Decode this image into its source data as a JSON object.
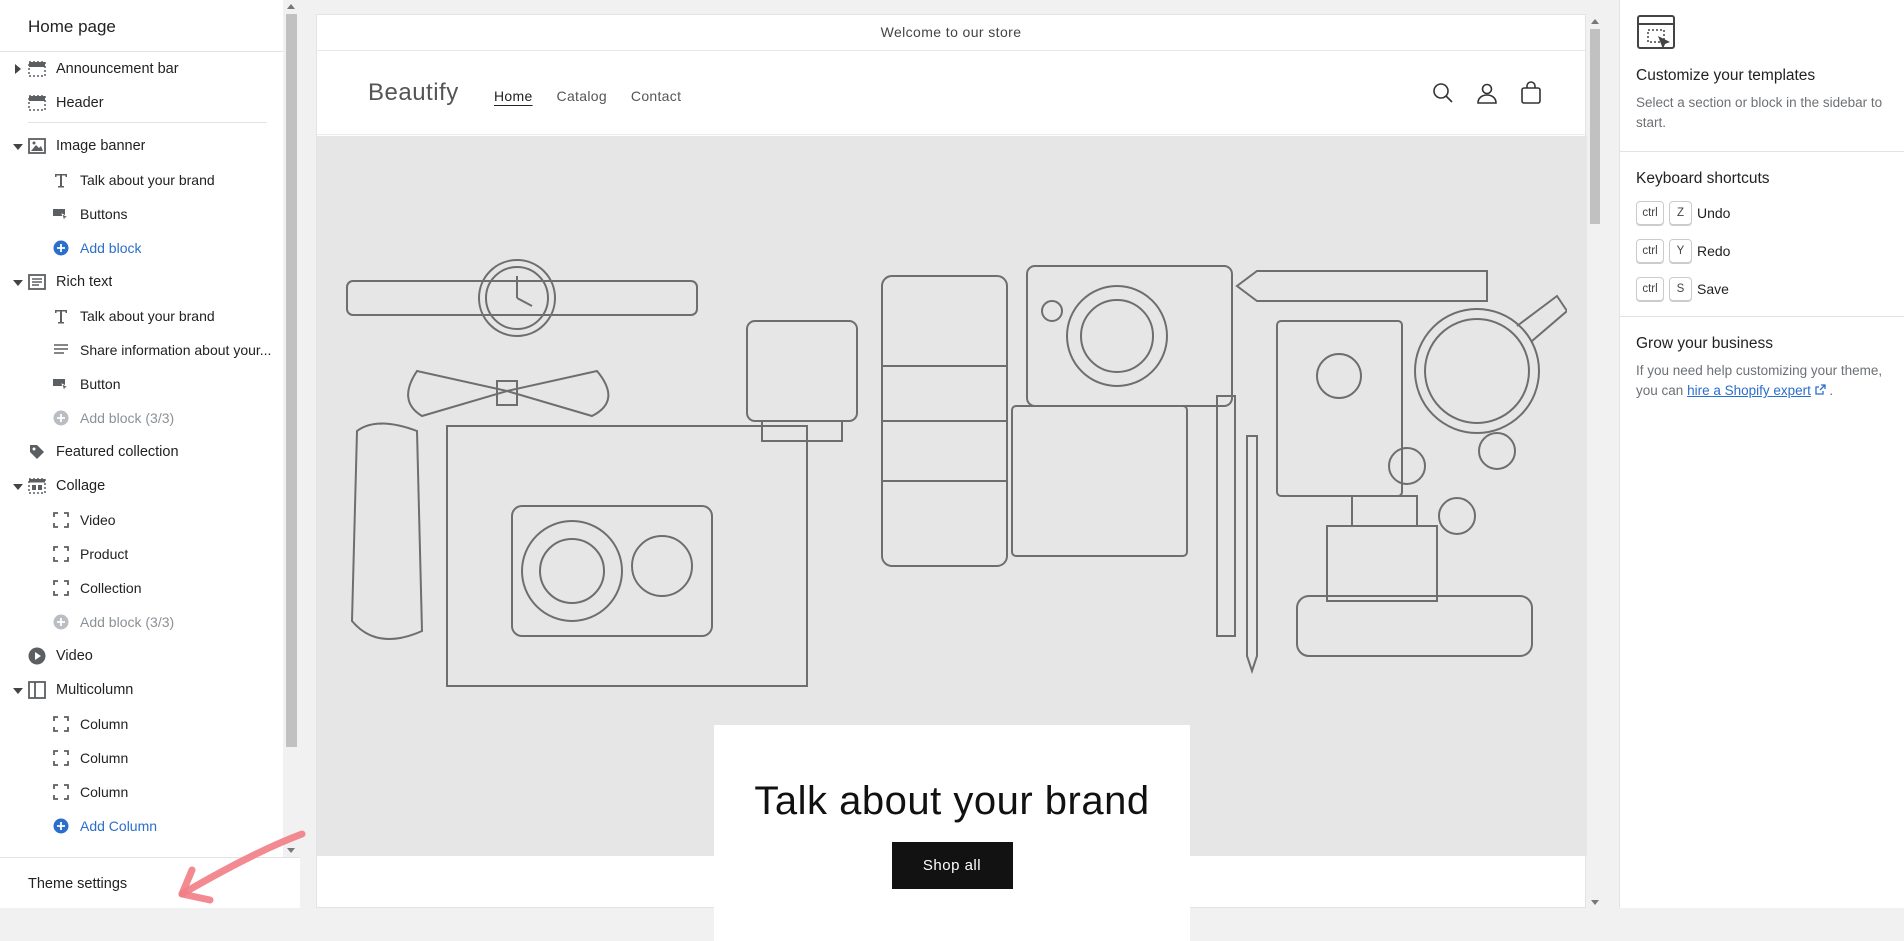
{
  "sidebar": {
    "title": "Home page",
    "items": [
      {
        "label": "Announcement bar"
      },
      {
        "label": "Header"
      },
      {
        "label": "Image banner"
      },
      {
        "label": "Talk about your brand"
      },
      {
        "label": "Buttons"
      },
      {
        "label": "Add block"
      },
      {
        "label": "Rich text"
      },
      {
        "label": "Talk about your brand"
      },
      {
        "label": "Share information about your..."
      },
      {
        "label": "Button"
      },
      {
        "label": "Add block (3/3)"
      },
      {
        "label": "Featured collection"
      },
      {
        "label": "Collage"
      },
      {
        "label": "Video"
      },
      {
        "label": "Product"
      },
      {
        "label": "Collection"
      },
      {
        "label": "Add block (3/3)"
      },
      {
        "label": "Video"
      },
      {
        "label": "Multicolumn"
      },
      {
        "label": "Column"
      },
      {
        "label": "Column"
      },
      {
        "label": "Column"
      },
      {
        "label": "Add Column"
      }
    ],
    "footer_label": "Theme settings"
  },
  "preview": {
    "announcement": "Welcome to our store",
    "logo": "Beautify",
    "nav": [
      "Home",
      "Catalog",
      "Contact"
    ],
    "banner_heading": "Talk about your brand",
    "banner_button": "Shop all"
  },
  "right_panel": {
    "customize_title": "Customize your templates",
    "customize_text": "Select a section or block in the sidebar to start.",
    "shortcuts_title": "Keyboard shortcuts",
    "shortcuts": [
      {
        "mod": "ctrl",
        "key": "Z",
        "action": "Undo"
      },
      {
        "mod": "ctrl",
        "key": "Y",
        "action": "Redo"
      },
      {
        "mod": "ctrl",
        "key": "S",
        "action": "Save"
      }
    ],
    "grow_title": "Grow your business",
    "grow_text": "If you need help customizing your theme, you can",
    "grow_link": "hire a Shopify expert",
    "grow_end": "."
  },
  "colors": {
    "link": "#2c6ecb",
    "button_bg": "#121212",
    "banner_bg": "#e6e6e6"
  }
}
